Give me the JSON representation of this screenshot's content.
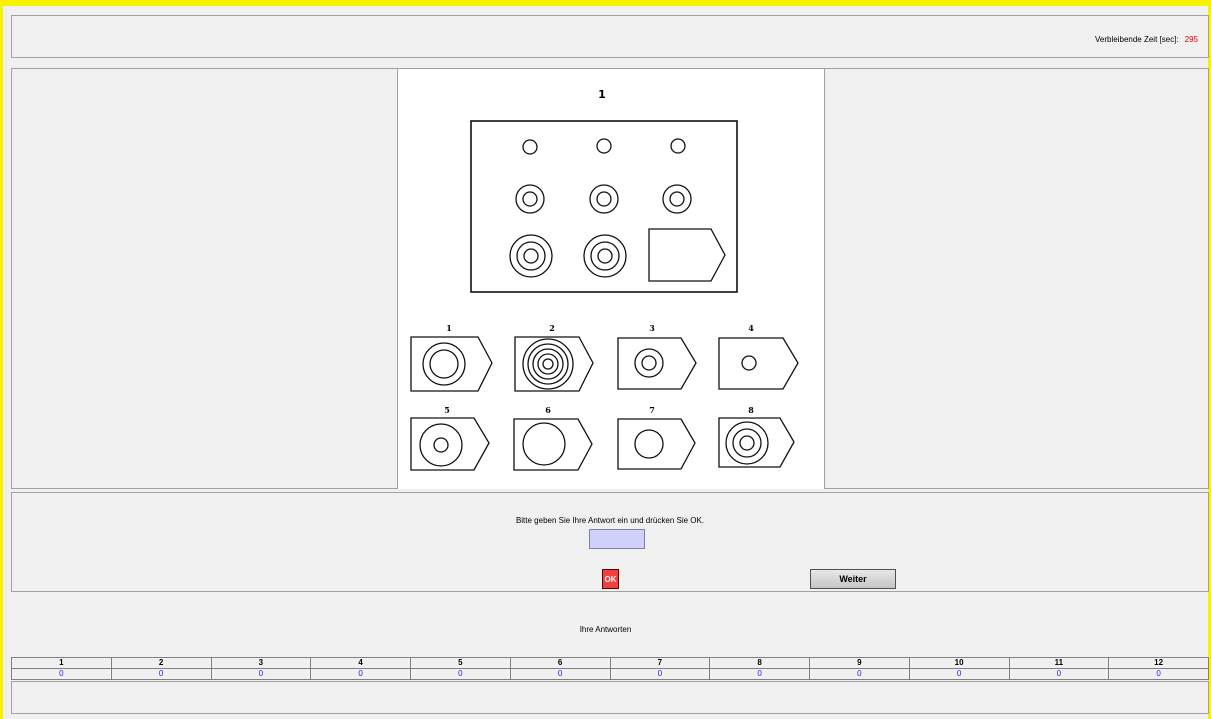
{
  "timer": {
    "label": "Verbleibende Zeit [sec]:",
    "value": "295"
  },
  "puzzle": {
    "number": "1",
    "option_numbers": [
      "1",
      "2",
      "3",
      "4",
      "5",
      "6",
      "7",
      "8"
    ]
  },
  "answer": {
    "instruction": "Bitte geben Sie Ihre Antwort ein und drücken Sie OK.",
    "input_value": "",
    "ok_label": "OK",
    "next_label": "Weiter"
  },
  "answers": {
    "title": "Ihre Antworten",
    "columns": [
      "1",
      "2",
      "3",
      "4",
      "5",
      "6",
      "7",
      "8",
      "9",
      "10",
      "11",
      "12"
    ],
    "values": [
      "0",
      "0",
      "0",
      "0",
      "0",
      "0",
      "0",
      "0",
      "0",
      "0",
      "0",
      "0"
    ]
  },
  "colors": {
    "frame": "#f7f300",
    "timer_value": "#e00000",
    "ok_button": "#f04040",
    "input_bg": "#d0d0ff",
    "answer_values": "#2020ff"
  }
}
